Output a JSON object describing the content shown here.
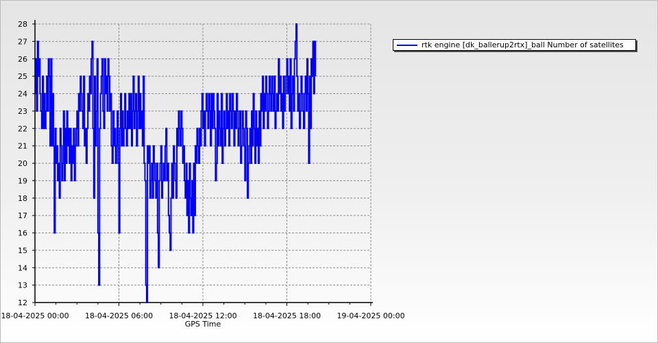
{
  "chart_data": {
    "type": "line",
    "xlabel": "GPS Time",
    "ylabel": "",
    "title": "",
    "grid": true,
    "legend_placement": "top-right",
    "color": "#0000ff",
    "x_tick_labels": [
      "18-04-2025 00:00",
      "18-04-2025 06:00",
      "18-04-2025 12:00",
      "18-04-2025 18:00",
      "19-04-2025 00:00"
    ],
    "xlim_hours": [
      0,
      24
    ],
    "ylim": [
      12,
      28
    ],
    "y_ticks": [
      12,
      13,
      14,
      15,
      16,
      17,
      18,
      19,
      20,
      21,
      22,
      23,
      24,
      25,
      26,
      27,
      28
    ],
    "series": [
      {
        "name": "rtk engine [dk_ballerup2rtx]_ball Number of satellites",
        "x_hours": [
          0.0,
          0.06,
          0.12,
          0.18,
          0.24,
          0.3,
          0.36,
          0.42,
          0.48,
          0.54,
          0.6,
          0.66,
          0.72,
          0.78,
          0.84,
          0.9,
          0.96,
          1.02,
          1.08,
          1.14,
          1.2,
          1.26,
          1.32,
          1.38,
          1.44,
          1.5,
          1.56,
          1.62,
          1.68,
          1.74,
          1.8,
          1.86,
          1.92,
          1.98,
          2.04,
          2.1,
          2.16,
          2.22,
          2.28,
          2.34,
          2.4,
          2.46,
          2.52,
          2.58,
          2.64,
          2.7,
          2.76,
          2.82,
          2.88,
          2.94,
          3.0,
          3.06,
          3.12,
          3.18,
          3.24,
          3.3,
          3.36,
          3.42,
          3.48,
          3.54,
          3.6,
          3.66,
          3.72,
          3.78,
          3.84,
          3.9,
          3.96,
          4.02,
          4.08,
          4.14,
          4.2,
          4.26,
          4.32,
          4.38,
          4.44,
          4.5,
          4.56,
          4.62,
          4.68,
          4.74,
          4.8,
          4.86,
          4.92,
          4.98,
          5.04,
          5.1,
          5.16,
          5.22,
          5.28,
          5.34,
          5.4,
          5.46,
          5.52,
          5.58,
          5.64,
          5.7,
          5.76,
          5.82,
          5.88,
          5.94,
          6.0,
          6.06,
          6.12,
          6.18,
          6.24,
          6.3,
          6.36,
          6.42,
          6.48,
          6.54,
          6.6,
          6.66,
          6.72,
          6.78,
          6.84,
          6.9,
          6.96,
          7.02,
          7.08,
          7.14,
          7.2,
          7.26,
          7.32,
          7.38,
          7.44,
          7.5,
          7.56,
          7.62,
          7.68,
          7.74,
          7.8,
          7.86,
          7.92,
          7.98,
          8.04,
          8.1,
          8.16,
          8.22,
          8.28,
          8.34,
          8.4,
          8.46,
          8.52,
          8.58,
          8.64,
          8.7,
          8.76,
          8.82,
          8.88,
          8.94,
          9.0,
          9.06,
          9.12,
          9.18,
          9.24,
          9.3,
          9.36,
          9.42,
          9.48,
          9.54,
          9.6,
          9.66,
          9.72,
          9.78,
          9.84,
          9.9,
          9.96,
          10.02,
          10.08,
          10.14,
          10.2,
          10.26,
          10.32,
          10.38,
          10.44,
          10.5,
          10.56,
          10.62,
          10.68,
          10.74,
          10.8,
          10.86,
          10.92,
          10.98,
          11.04,
          11.1,
          11.16,
          11.22,
          11.28,
          11.34,
          11.4,
          11.46,
          11.52,
          11.58,
          11.64,
          11.7,
          11.76,
          11.82,
          11.88,
          11.94,
          12.0,
          12.06,
          12.12,
          12.18,
          12.24,
          12.3,
          12.36,
          12.42,
          12.48,
          12.54,
          12.6,
          12.66,
          12.72,
          12.78,
          12.84,
          12.9,
          12.96,
          13.02,
          13.08,
          13.14,
          13.2,
          13.26,
          13.32,
          13.38,
          13.44,
          13.5,
          13.56,
          13.62,
          13.68,
          13.74,
          13.8,
          13.86,
          13.92,
          13.98,
          14.04,
          14.1,
          14.16,
          14.22,
          14.28,
          14.34,
          14.4,
          14.46,
          14.52,
          14.58,
          14.64,
          14.7,
          14.76,
          14.82,
          14.88,
          14.94,
          15.0,
          15.06,
          15.12,
          15.18,
          15.24,
          15.3,
          15.36,
          15.42,
          15.48,
          15.54,
          15.6,
          15.66,
          15.72,
          15.78,
          15.84,
          15.9,
          15.96,
          16.02,
          16.08,
          16.14,
          16.2,
          16.26,
          16.32,
          16.38,
          16.44,
          16.5,
          16.56,
          16.62,
          16.68,
          16.74,
          16.8,
          16.86,
          16.92,
          16.98,
          17.04,
          17.1,
          17.16,
          17.22,
          17.28,
          17.34,
          17.4,
          17.46,
          17.52,
          17.58,
          17.64,
          17.7,
          17.76,
          17.82,
          17.88,
          17.94,
          18.0,
          18.06,
          18.12,
          18.18,
          18.24,
          18.3,
          18.36,
          18.42,
          18.48,
          18.54,
          18.6,
          18.66,
          18.72,
          18.78,
          18.84,
          18.9,
          18.96,
          19.02,
          19.08,
          19.14,
          19.2,
          19.26,
          19.32,
          19.38,
          19.44,
          19.5,
          19.56,
          19.62,
          19.68,
          19.74,
          19.8,
          19.86,
          19.92,
          19.98,
          20.04,
          20.1,
          20.16,
          20.22,
          20.28,
          20.34,
          20.4,
          20.46,
          20.52,
          20.58,
          20.64,
          20.7,
          20.76,
          20.82,
          20.88,
          20.94,
          21.0,
          21.06,
          21.12,
          21.18,
          21.24,
          21.3,
          21.36,
          21.42,
          21.48,
          21.54,
          21.6,
          21.66,
          21.72,
          21.78,
          21.84,
          21.9,
          21.96,
          22.02,
          22.08,
          22.14,
          22.2,
          22.26,
          22.32,
          22.38,
          22.44,
          22.5,
          22.56,
          22.62,
          22.68,
          22.74,
          22.8,
          22.86,
          22.92,
          22.98,
          23.04,
          23.1,
          23.16,
          23.22,
          23.28,
          23.34,
          23.4,
          23.46,
          23.52,
          23.58,
          23.64,
          23.7,
          23.76,
          23.82,
          23.88,
          23.94,
          24.0
        ],
        "values": [
          24,
          26,
          23,
          27,
          25,
          26,
          24,
          23,
          22,
          25,
          22,
          24,
          22,
          23,
          25,
          23,
          26,
          25,
          21,
          26,
          21,
          24,
          21,
          16,
          22,
          20,
          21,
          19,
          20,
          18,
          22,
          21,
          19,
          20,
          23,
          19,
          22,
          20,
          23,
          21,
          22,
          20,
          22,
          19,
          21,
          20,
          22,
          19,
          21,
          22,
          23,
          21,
          24,
          23,
          25,
          24,
          23,
          22,
          25,
          21,
          22,
          20,
          22,
          24,
          23,
          25,
          24,
          26,
          27,
          22,
          18,
          25,
          21,
          23,
          26,
          16,
          13,
          22,
          24,
          25,
          26,
          23,
          22,
          26,
          24,
          25,
          23,
          26,
          25,
          23,
          24,
          21,
          20,
          23,
          21,
          22,
          20,
          21,
          23,
          20,
          16,
          22,
          24,
          21,
          23,
          21,
          22,
          24,
          22,
          21,
          23,
          22,
          24,
          22,
          24,
          21,
          23,
          25,
          22,
          23,
          24,
          21,
          23,
          25,
          22,
          24,
          22,
          23,
          21,
          25,
          20,
          19,
          13,
          12,
          21,
          20,
          21,
          18,
          19,
          20,
          18,
          21,
          20,
          19,
          18,
          20,
          16,
          14,
          19,
          20,
          21,
          18,
          19,
          20,
          19,
          21,
          22,
          19,
          20,
          17,
          16,
          15,
          18,
          20,
          18,
          21,
          20,
          19,
          18,
          22,
          21,
          23,
          22,
          21,
          23,
          22,
          20,
          21,
          19,
          18,
          20,
          17,
          19,
          16,
          20,
          18,
          17,
          19,
          16,
          20,
          17,
          21,
          20,
          22,
          21,
          20,
          22,
          21,
          23,
          24,
          22,
          23,
          21,
          23,
          24,
          23,
          22,
          24,
          23,
          21,
          24,
          22,
          24,
          23,
          22,
          19,
          20,
          24,
          21,
          23,
          22,
          21,
          24,
          20,
          22,
          23,
          21,
          22,
          24,
          22,
          23,
          21,
          24,
          23,
          22,
          24,
          23,
          21,
          23,
          22,
          24,
          23,
          21,
          22,
          23,
          20,
          21,
          23,
          22,
          21,
          19,
          23,
          22,
          18,
          20,
          21,
          22,
          20,
          23,
          21,
          24,
          22,
          20,
          23,
          21,
          22,
          20,
          23,
          21,
          24,
          23,
          25,
          22,
          24,
          23,
          25,
          24,
          22,
          23,
          25,
          24,
          23,
          25,
          24,
          23,
          25,
          22,
          23,
          24,
          23,
          26,
          24,
          25,
          23,
          24,
          22,
          25,
          23,
          24,
          25,
          26,
          24,
          25,
          23,
          26,
          22,
          24,
          25,
          23,
          26,
          27,
          28,
          25,
          23,
          24,
          22,
          23,
          25,
          24,
          23,
          22,
          24,
          25,
          23,
          26,
          24,
          20,
          25,
          22,
          26,
          25,
          27,
          24,
          27,
          25
        ]
      }
    ]
  }
}
